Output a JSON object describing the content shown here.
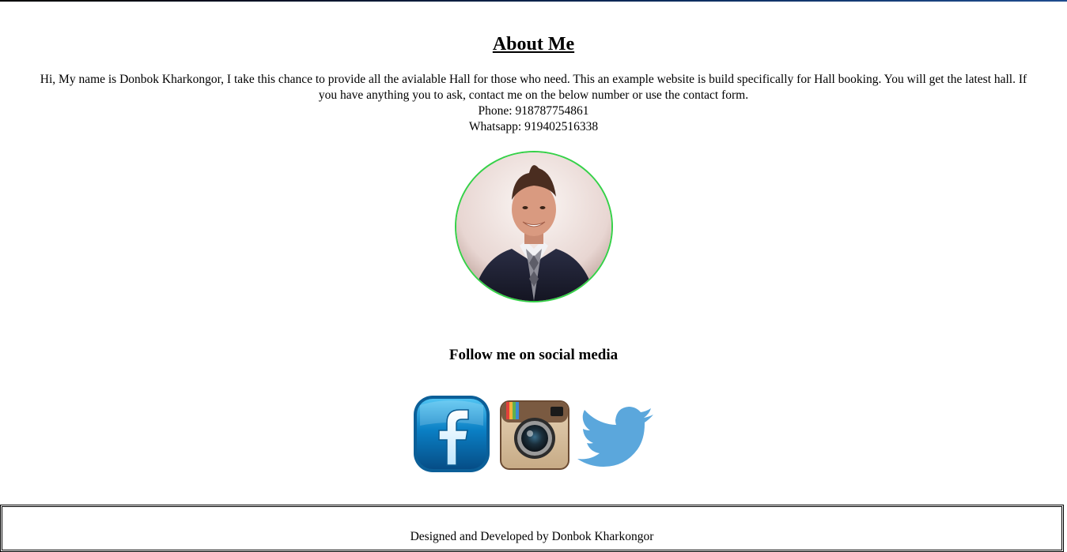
{
  "about": {
    "title": "About Me",
    "intro_line1": "Hi, My name is Donbok Kharkongor, I take this chance to provide all the avialable Hall for those who need. This an example website is build specifically for Hall booking. You will get the latest hall. If",
    "intro_line2": "you have anything you to ask, contact me on the below number or use the contact form.",
    "phone": "Phone: 918787754861",
    "whatsapp": "Whatsapp: 919402516338",
    "avatar_border_color": "#35d148"
  },
  "social": {
    "title": "Follow me on social media",
    "links": [
      {
        "name": "facebook-icon",
        "color": "#0a7fc4"
      },
      {
        "name": "instagram-icon",
        "color": "#b08a60"
      },
      {
        "name": "twitter-icon",
        "color": "#5ba7dc"
      }
    ],
    "facebook_glyph": "f"
  },
  "footer": {
    "text": "Designed and Developed by Donbok Kharkongor"
  }
}
